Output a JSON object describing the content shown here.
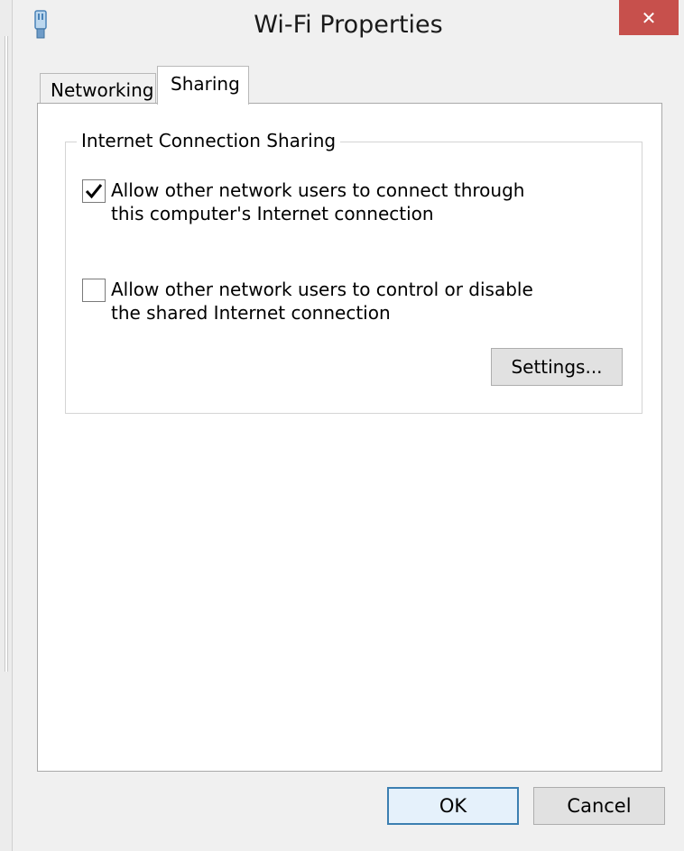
{
  "window": {
    "title": "Wi-Fi Properties",
    "close_glyph": "✕",
    "app_icon": "network-adapter-icon"
  },
  "tabs": [
    {
      "label": "Networking",
      "selected": false
    },
    {
      "label": "Sharing",
      "selected": true
    }
  ],
  "sharing": {
    "group_title": "Internet Connection Sharing",
    "options": [
      {
        "label": "Allow other network users to connect through this computer's Internet connection",
        "checked": true
      },
      {
        "label": "Allow other network users to control or disable the shared Internet connection",
        "checked": false
      }
    ],
    "settings_label": "Settings..."
  },
  "buttons": {
    "ok_label": "OK",
    "cancel_label": "Cancel"
  },
  "colors": {
    "close_button": "#c7504c",
    "default_button_border": "#3c7fb1"
  }
}
